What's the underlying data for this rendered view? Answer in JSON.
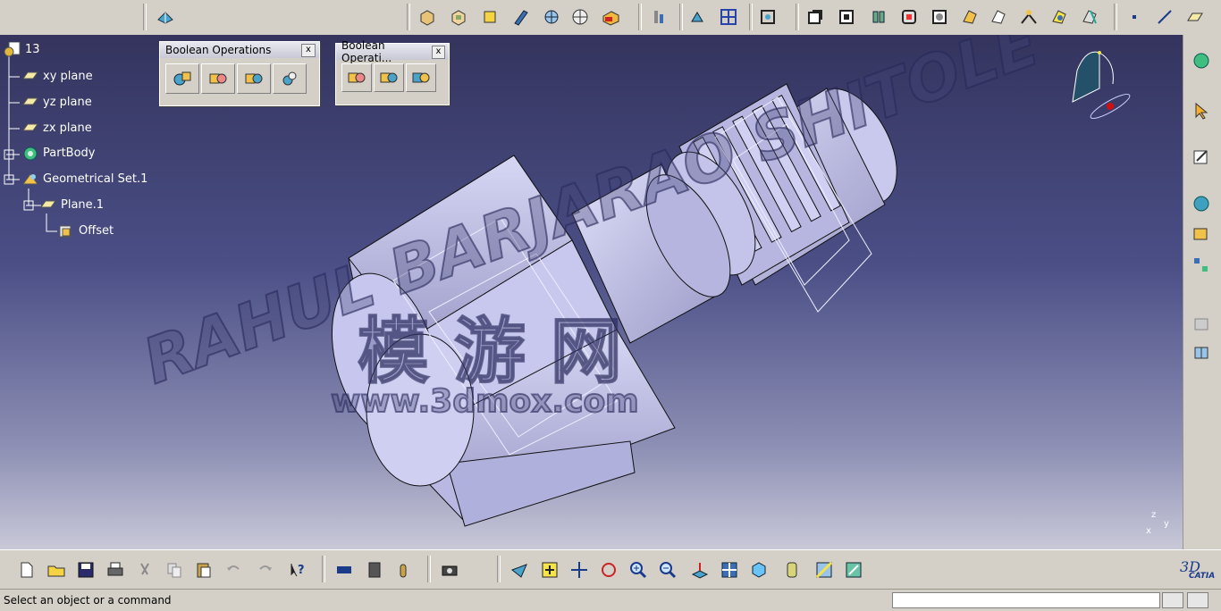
{
  "tree": {
    "root": "13",
    "items": [
      {
        "label": "xy plane",
        "icon": "plane-icon"
      },
      {
        "label": "yz plane",
        "icon": "plane-icon"
      },
      {
        "label": "zx plane",
        "icon": "plane-icon"
      },
      {
        "label": "PartBody",
        "icon": "partbody-gear-icon"
      },
      {
        "label": "Geometrical Set.1",
        "icon": "geometrical-set-icon"
      },
      {
        "label": "Plane.1",
        "icon": "plane-icon"
      },
      {
        "label": "Offset",
        "icon": "offset-icon"
      }
    ]
  },
  "panels": [
    {
      "title": "Boolean Operations",
      "close": "x"
    },
    {
      "title": "Boolean Operati...",
      "close": "x"
    }
  ],
  "watermark": {
    "line1": "RAHUL BARJARAO SHITOLE",
    "line2": "www.3dmox.com",
    "chinese": "模 游 网"
  },
  "status": {
    "message": "Select an object or a command"
  },
  "compass_axes": {
    "z": "z",
    "y": "y",
    "x": "x"
  },
  "brand": "CATIA",
  "colors": {
    "viewport_top": "#34345e",
    "viewport_bottom": "#c8c8d8",
    "part": "#c8c8ec",
    "tree_text": "#ffffff"
  }
}
